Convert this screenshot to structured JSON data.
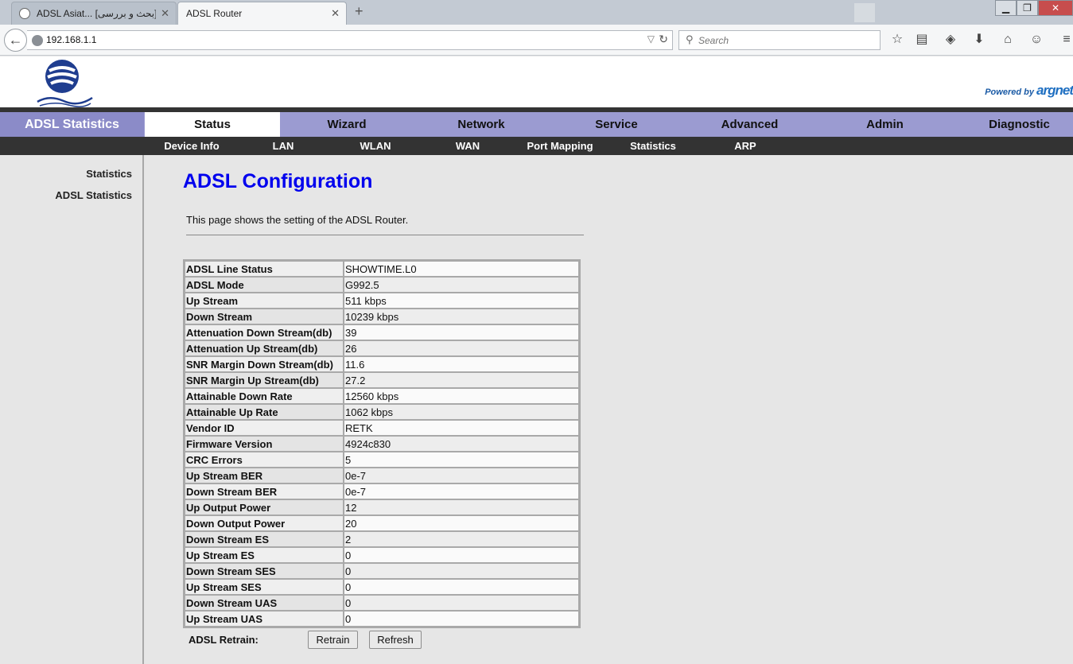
{
  "browser": {
    "tabs": [
      {
        "title": "ADSL Asiat... [بحث و بررسی]",
        "close": "✕"
      },
      {
        "title": "ADSL Router",
        "close": "✕"
      }
    ],
    "new_tab": "+",
    "window": {
      "minimize": "▁",
      "restore": "❐",
      "close": "✕"
    },
    "back": "←",
    "url": "192.168.1.1",
    "url_dropdown": "▽",
    "reload": "↻",
    "search_placeholder": "Search",
    "search_icon": "⚲",
    "toolbar_icons": [
      "☆",
      "▤",
      "◈",
      "⬇",
      "⌂",
      "☺",
      "≡"
    ]
  },
  "banner": {
    "powered_by": "Powered by",
    "brand": "argnet"
  },
  "menu": {
    "section_title": "ADSL Statistics",
    "items": [
      "Status",
      "Wizard",
      "Network",
      "Service",
      "Advanced",
      "Admin",
      "Diagnostic"
    ],
    "active": "Status"
  },
  "submenu": {
    "items": [
      "Device Info",
      "LAN",
      "WLAN",
      "WAN",
      "Port Mapping",
      "Statistics",
      "ARP"
    ]
  },
  "sidebar": {
    "links": [
      "Statistics",
      "ADSL Statistics"
    ]
  },
  "content": {
    "title": "ADSL Configuration",
    "description": "This page shows the setting of the ADSL Router.",
    "rows": [
      [
        "ADSL Line Status",
        "SHOWTIME.L0"
      ],
      [
        "ADSL Mode",
        "G992.5"
      ],
      [
        "Up Stream",
        "511 kbps"
      ],
      [
        "Down Stream",
        "10239 kbps"
      ],
      [
        "Attenuation Down Stream(db)",
        "39"
      ],
      [
        "Attenuation Up Stream(db)",
        "26"
      ],
      [
        "SNR Margin Down Stream(db)",
        "11.6"
      ],
      [
        "SNR Margin Up Stream(db)",
        "27.2"
      ],
      [
        "Attainable Down Rate",
        "12560 kbps"
      ],
      [
        "Attainable Up Rate",
        "1062 kbps"
      ],
      [
        "Vendor ID",
        "RETK"
      ],
      [
        "Firmware Version",
        "4924c830"
      ],
      [
        "CRC Errors",
        "5"
      ],
      [
        "Up Stream BER",
        "0e-7"
      ],
      [
        "Down Stream BER",
        "0e-7"
      ],
      [
        "Up Output Power",
        "12"
      ],
      [
        "Down Output Power",
        "20"
      ],
      [
        "Down Stream ES",
        "2"
      ],
      [
        "Up Stream ES",
        "0"
      ],
      [
        "Down Stream SES",
        "0"
      ],
      [
        "Up Stream SES",
        "0"
      ],
      [
        "Down Stream UAS",
        "0"
      ],
      [
        "Up Stream UAS",
        "0"
      ]
    ],
    "retrain_label": "ADSL Retrain:",
    "retrain_button": "Retrain",
    "refresh_button": "Refresh"
  }
}
